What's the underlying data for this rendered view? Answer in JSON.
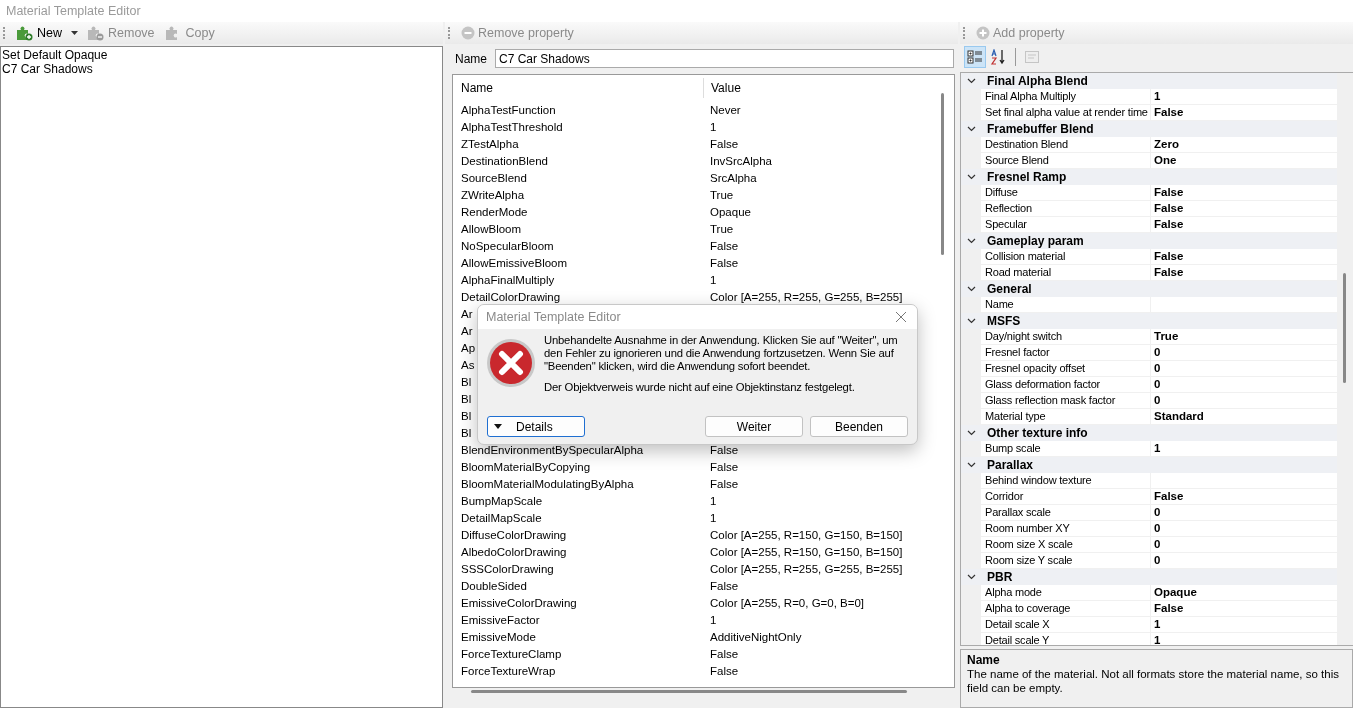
{
  "window": {
    "title": "Material Template Editor"
  },
  "left_toolbar": [
    {
      "label": "New",
      "kind": "new",
      "disabled": false,
      "dropdown": true
    },
    {
      "label": "Remove",
      "kind": "remove",
      "disabled": true,
      "dropdown": false
    },
    {
      "label": "Copy",
      "kind": "copy",
      "disabled": true,
      "dropdown": false
    }
  ],
  "templates": [
    {
      "label": "Set Default Opaque"
    },
    {
      "label": "C7 Car Shadows"
    }
  ],
  "middle_toolbar": {
    "label": "Remove property",
    "disabled": true
  },
  "name_field": {
    "label": "Name",
    "value": "C7 Car Shadows"
  },
  "properties_table": {
    "columns": [
      "Name",
      "Value"
    ],
    "rows": [
      {
        "name": "AlphaTestFunction",
        "value": "Never"
      },
      {
        "name": "AlphaTestThreshold",
        "value": "1"
      },
      {
        "name": "ZTestAlpha",
        "value": "False"
      },
      {
        "name": "DestinationBlend",
        "value": "InvSrcAlpha"
      },
      {
        "name": "SourceBlend",
        "value": "SrcAlpha"
      },
      {
        "name": "ZWriteAlpha",
        "value": "True"
      },
      {
        "name": "RenderMode",
        "value": "Opaque"
      },
      {
        "name": "AllowBloom",
        "value": "True"
      },
      {
        "name": "NoSpecularBloom",
        "value": "False"
      },
      {
        "name": "AllowEmissiveBloom",
        "value": "False"
      },
      {
        "name": "AlphaFinalMultiply",
        "value": "1"
      },
      {
        "name": "DetailColorDrawing",
        "value": "Color [A=255, R=255, G=255, B=255]"
      },
      {
        "name": "Ar"
      },
      {
        "name": "Ar"
      },
      {
        "name": "Ap"
      },
      {
        "name": "As"
      },
      {
        "name": "Bl"
      },
      {
        "name": "Bl"
      },
      {
        "name": "Bl"
      },
      {
        "name": "Bl"
      },
      {
        "name": "BlendEnvironmentBySpecularAlpha",
        "value": "False"
      },
      {
        "name": "BloomMaterialByCopying",
        "value": "False"
      },
      {
        "name": "BloomMaterialModulatingByAlpha",
        "value": "False"
      },
      {
        "name": "BumpMapScale",
        "value": "1"
      },
      {
        "name": "DetailMapScale",
        "value": "1"
      },
      {
        "name": "DiffuseColorDrawing",
        "value": "Color [A=255, R=150, G=150, B=150]"
      },
      {
        "name": "AlbedoColorDrawing",
        "value": "Color [A=255, R=150, G=150, B=150]"
      },
      {
        "name": "SSSColorDrawing",
        "value": "Color [A=255, R=255, G=255, B=255]"
      },
      {
        "name": "DoubleSided",
        "value": "False"
      },
      {
        "name": "EmissiveColorDrawing",
        "value": "Color [A=255, R=0, G=0, B=0]"
      },
      {
        "name": "EmissiveFactor",
        "value": "1"
      },
      {
        "name": "EmissiveMode",
        "value": "AdditiveNightOnly"
      },
      {
        "name": "ForceTextureClamp",
        "value": "False"
      },
      {
        "name": "ForceTextureWrap",
        "value": "False"
      }
    ]
  },
  "right_toolbar": {
    "label": "Add property",
    "disabled": true
  },
  "grid_toolbar": [
    {
      "kind": "categorized",
      "selected": true,
      "disabled": false
    },
    {
      "kind": "alphabetical",
      "selected": false,
      "disabled": false
    },
    {
      "kind": "pages",
      "selected": false,
      "disabled": true
    }
  ],
  "property_grid": [
    {
      "category": "Final Alpha Blend",
      "expanded": true,
      "items": [
        {
          "name": "Final Alpha Multiply",
          "value": "1"
        },
        {
          "name": "Set final alpha value at render time",
          "value": "False"
        }
      ]
    },
    {
      "category": "Framebuffer Blend",
      "expanded": true,
      "items": [
        {
          "name": "Destination Blend",
          "value": "Zero"
        },
        {
          "name": "Source Blend",
          "value": "One"
        }
      ]
    },
    {
      "category": "Fresnel Ramp",
      "expanded": true,
      "items": [
        {
          "name": "Diffuse",
          "value": "False"
        },
        {
          "name": "Reflection",
          "value": "False"
        },
        {
          "name": "Specular",
          "value": "False"
        }
      ]
    },
    {
      "category": "Gameplay param",
      "expanded": true,
      "items": [
        {
          "name": "Collision material",
          "value": "False"
        },
        {
          "name": "Road material",
          "value": "False"
        }
      ]
    },
    {
      "category": "General",
      "expanded": true,
      "items": [
        {
          "name": "Name"
        }
      ]
    },
    {
      "category": "MSFS",
      "expanded": true,
      "items": [
        {
          "name": "Day/night switch",
          "value": "True"
        },
        {
          "name": "Fresnel factor",
          "value": "0"
        },
        {
          "name": "Fresnel opacity offset",
          "value": "0"
        },
        {
          "name": "Glass deformation factor",
          "value": "0"
        },
        {
          "name": "Glass reflection mask factor",
          "value": "0"
        },
        {
          "name": "Material type",
          "value": "Standard"
        }
      ]
    },
    {
      "category": "Other texture info",
      "expanded": true,
      "items": [
        {
          "name": "Bump scale",
          "value": "1"
        }
      ]
    },
    {
      "category": "Parallax",
      "expanded": true,
      "items": [
        {
          "name": "Behind window texture"
        },
        {
          "name": "Corridor",
          "value": "False"
        },
        {
          "name": "Parallax scale",
          "value": "0"
        },
        {
          "name": "Room number XY",
          "value": "0"
        },
        {
          "name": "Room size X scale",
          "value": "0"
        },
        {
          "name": "Room size Y scale",
          "value": "0"
        }
      ]
    },
    {
      "category": "PBR",
      "expanded": true,
      "items": [
        {
          "name": "Alpha mode",
          "value": "Opaque"
        },
        {
          "name": "Alpha to coverage",
          "value": "False"
        },
        {
          "name": "Detail scale X",
          "value": "1"
        },
        {
          "name": "Detail scale Y",
          "value": "1"
        }
      ]
    }
  ],
  "help": {
    "title": "Name",
    "text": "The name of the material. Not all formats store the material name, so this field can be empty."
  },
  "dialog": {
    "title": "Material Template Editor",
    "message": "Unbehandelte Ausnahme in der Anwendung. Klicken Sie auf \"Weiter\", um den Fehler zu ignorieren und die Anwendung fortzusetzen. Wenn Sie auf \"Beenden\" klicken, wird die Anwendung sofort beendet.",
    "detail": "Der Objektverweis wurde nicht auf eine Objektinstanz festgelegt.",
    "buttons": [
      {
        "label": "Details",
        "kind": "expander"
      },
      {
        "label": "Weiter",
        "kind": "normal"
      },
      {
        "label": "Beenden",
        "kind": "normal"
      }
    ]
  }
}
